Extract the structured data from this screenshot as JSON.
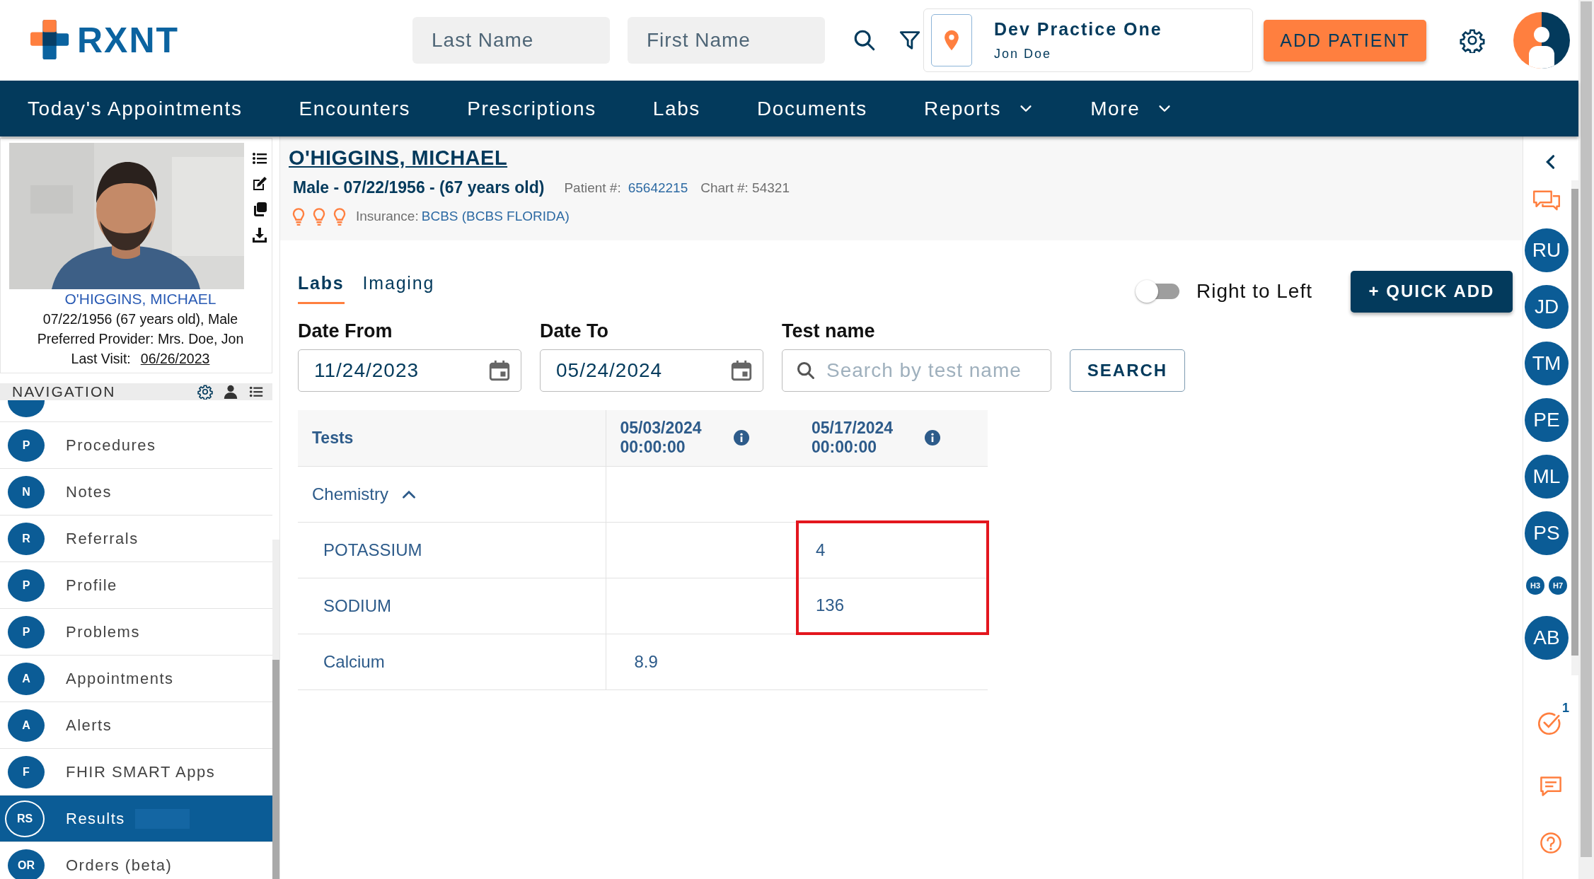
{
  "header": {
    "logo": "RXNT",
    "last_name": {
      "placeholder": "Last Name"
    },
    "first_name": {
      "placeholder": "First Name"
    },
    "practice": {
      "name": "Dev Practice One",
      "user": "Jon Doe"
    },
    "add_button": "ADD PATIENT"
  },
  "menu": [
    {
      "label": "Today's Appointments",
      "dropdown": false
    },
    {
      "label": "Encounters",
      "dropdown": false
    },
    {
      "label": "Prescriptions",
      "dropdown": false
    },
    {
      "label": "Labs",
      "dropdown": false
    },
    {
      "label": "Documents",
      "dropdown": false
    },
    {
      "label": "Reports",
      "dropdown": true
    },
    {
      "label": "More",
      "dropdown": true
    }
  ],
  "patient_card": {
    "name": "O'HIGGINS, MICHAEL",
    "details": "07/22/1956 (67 years old), Male",
    "provider": "Preferred Provider: Mrs. Doe, Jon",
    "last_visit_label": "Last Visit:",
    "last_visit": "06/26/2023"
  },
  "navigation": {
    "title": "NAVIGATION",
    "items": [
      {
        "initials": "P",
        "label": "Procedures",
        "selected": false
      },
      {
        "initials": "N",
        "label": "Notes",
        "selected": false
      },
      {
        "initials": "R",
        "label": "Referrals",
        "selected": false
      },
      {
        "initials": "P",
        "label": "Profile",
        "selected": false
      },
      {
        "initials": "P",
        "label": "Problems",
        "selected": false
      },
      {
        "initials": "A",
        "label": "Appointments",
        "selected": false
      },
      {
        "initials": "A",
        "label": "Alerts",
        "selected": false
      },
      {
        "initials": "F",
        "label": "FHIR SMART Apps",
        "selected": false
      },
      {
        "initials": "RS",
        "label": "Results",
        "selected": true
      },
      {
        "initials": "OR",
        "label": "Orders (beta)",
        "selected": false
      }
    ]
  },
  "patient": {
    "name": "O'HIGGINS, MICHAEL",
    "summary": "Male - 07/22/1956 - (67 years old)",
    "patient_no_label": "Patient #:",
    "patient_no": "65642215",
    "chart_no": "Chart #: 54321",
    "insurance_label": "Insurance:",
    "insurance": "BCBS (BCBS FLORIDA)"
  },
  "tabs": [
    {
      "label": "Labs",
      "selected": true
    },
    {
      "label": "Imaging",
      "selected": false
    }
  ],
  "direction_toggle": {
    "label": "Right to Left",
    "on": false
  },
  "quick_add": "+ QUICK ADD",
  "filters": [
    {
      "kind": "date",
      "label": "Date From",
      "value": "11/24/2023"
    },
    {
      "kind": "date",
      "label": "Date To",
      "value": "05/24/2024"
    },
    {
      "kind": "search",
      "label": "Test name",
      "placeholder": "Search by test name"
    }
  ],
  "search_button": "SEARCH",
  "table": {
    "columns": [
      {
        "label": "Tests",
        "info": false
      },
      {
        "label": "05/03/2024 00:00:00",
        "info": true
      },
      {
        "label": "05/17/2024 00:00:00",
        "info": true
      }
    ],
    "rows": [
      {
        "kind": "group",
        "label": "Chemistry",
        "expanded": true
      },
      {
        "kind": "test",
        "label": "POTASSIUM",
        "cells": [
          null,
          {
            "text": "4",
            "highlighted": true
          }
        ]
      },
      {
        "kind": "test",
        "label": "SODIUM",
        "cells": [
          null,
          {
            "text": "136",
            "highlighted": true
          }
        ]
      },
      {
        "kind": "test",
        "label": "Calcium",
        "cells": [
          {
            "text": "8.9",
            "highlighted": false
          },
          null
        ]
      }
    ]
  },
  "rail": {
    "contacts": [
      {
        "initials": "RU",
        "kind": "large"
      },
      {
        "initials": "JD",
        "kind": "large"
      },
      {
        "initials": "TM",
        "kind": "large"
      },
      {
        "initials": "PE",
        "kind": "large"
      },
      {
        "initials": "ML",
        "kind": "large"
      },
      {
        "initials": "PS",
        "kind": "large"
      },
      {
        "initials": "H3",
        "kind": "small"
      },
      {
        "initials": "H7",
        "kind": "small"
      },
      {
        "initials": "AB",
        "kind": "large"
      }
    ],
    "tasks_badge": "1"
  }
}
